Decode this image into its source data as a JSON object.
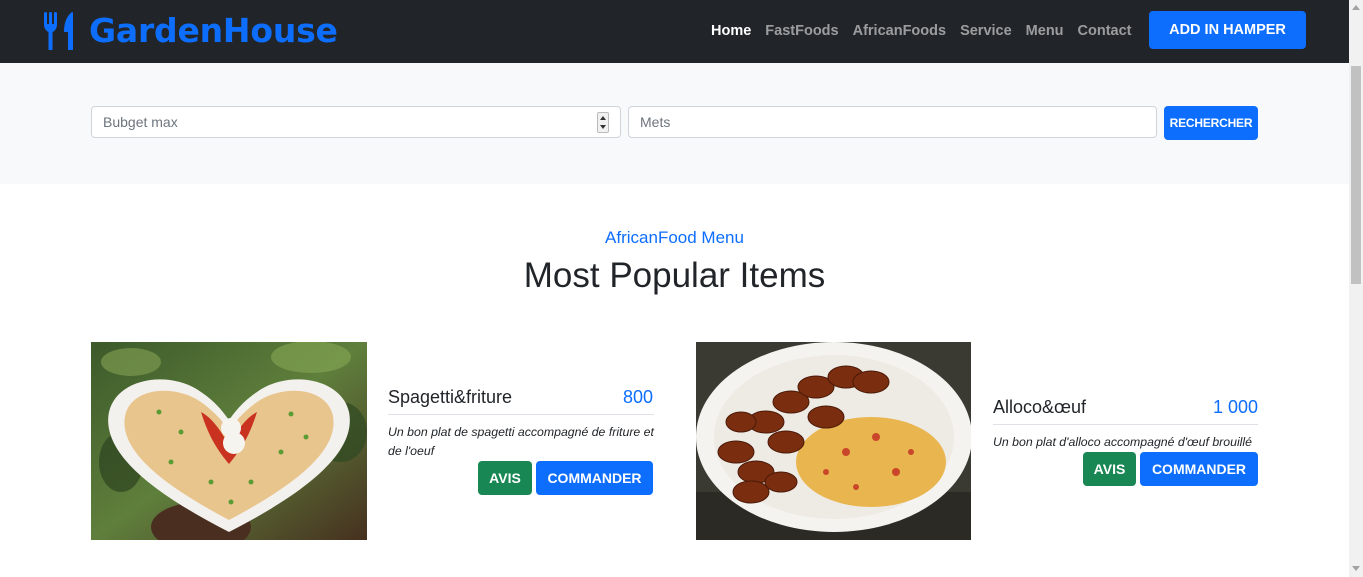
{
  "navbar": {
    "brand": "GardenHouse",
    "links": [
      "Home",
      "FastFoods",
      "AfricanFoods",
      "Service",
      "Menu",
      "Contact"
    ],
    "cta": "ADD IN HAMPER",
    "brand_color": "#0d6efd"
  },
  "search": {
    "budget_placeholder": "Bubget max",
    "mets_placeholder": "Mets",
    "button": "RECHERCHER"
  },
  "section": {
    "subtitle": "AfricanFood Menu",
    "title": "Most Popular Items"
  },
  "items": [
    {
      "name": "Spagetti&friture",
      "price": "800",
      "description": "Un bon plat de spagetti accompagné de friture et de l'oeuf",
      "review_label": "AVIS",
      "order_label": "COMMANDER",
      "image": "heart-shaped spaghetti plate with tomato sauce and eggs"
    },
    {
      "name": "Alloco&œuf",
      "price": "1 000",
      "description": "Un bon plat d'alloco accompagné d'œuf brouillé",
      "review_label": "AVIS",
      "order_label": "COMMANDER",
      "image": "fried plantain and scrambled eggs on white plate"
    }
  ]
}
